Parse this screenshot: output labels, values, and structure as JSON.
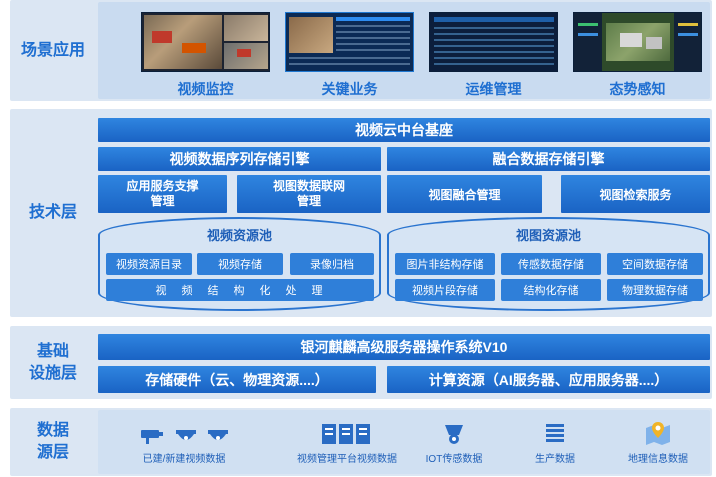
{
  "layers": {
    "scene": "场景应用",
    "tech": "技术层",
    "infra": "基础\n设施层",
    "data": "数据\n源层"
  },
  "scene_apps": [
    "视频监控",
    "关键业务",
    "运维管理",
    "态势感知"
  ],
  "tech": {
    "platform": "视频云中台基座",
    "left_engine": "视频数据序列存储引擎",
    "right_engine": "融合数据存储引擎",
    "svc1": "应用服务支撑\n管理",
    "svc2": "视图数据联网\n管理",
    "svc3": "视图融合管理",
    "svc4": "视图检索服务",
    "pool_left": {
      "title": "视频资源池",
      "items": [
        "视频资源目录",
        "视频存储",
        "录像归档"
      ],
      "wide": "视　频　结　构　化　处　理"
    },
    "pool_right": {
      "title": "视图资源池",
      "items": [
        "图片非结构存储",
        "传感数据存储",
        "空间数据存储",
        "视频片段存储",
        "结构化存储",
        "物理数据存储"
      ]
    }
  },
  "infra": {
    "os": "银河麒麟高级服务器操作系统V10",
    "storage": "存储硬件（云、物理资源....）",
    "compute": "计算资源（AI服务器、应用服务器....）"
  },
  "data_sources": [
    "已建/新建视频数据",
    "视频管理平台视频数据",
    "IOT传感数据",
    "生产数据",
    "地理信息数据"
  ]
}
